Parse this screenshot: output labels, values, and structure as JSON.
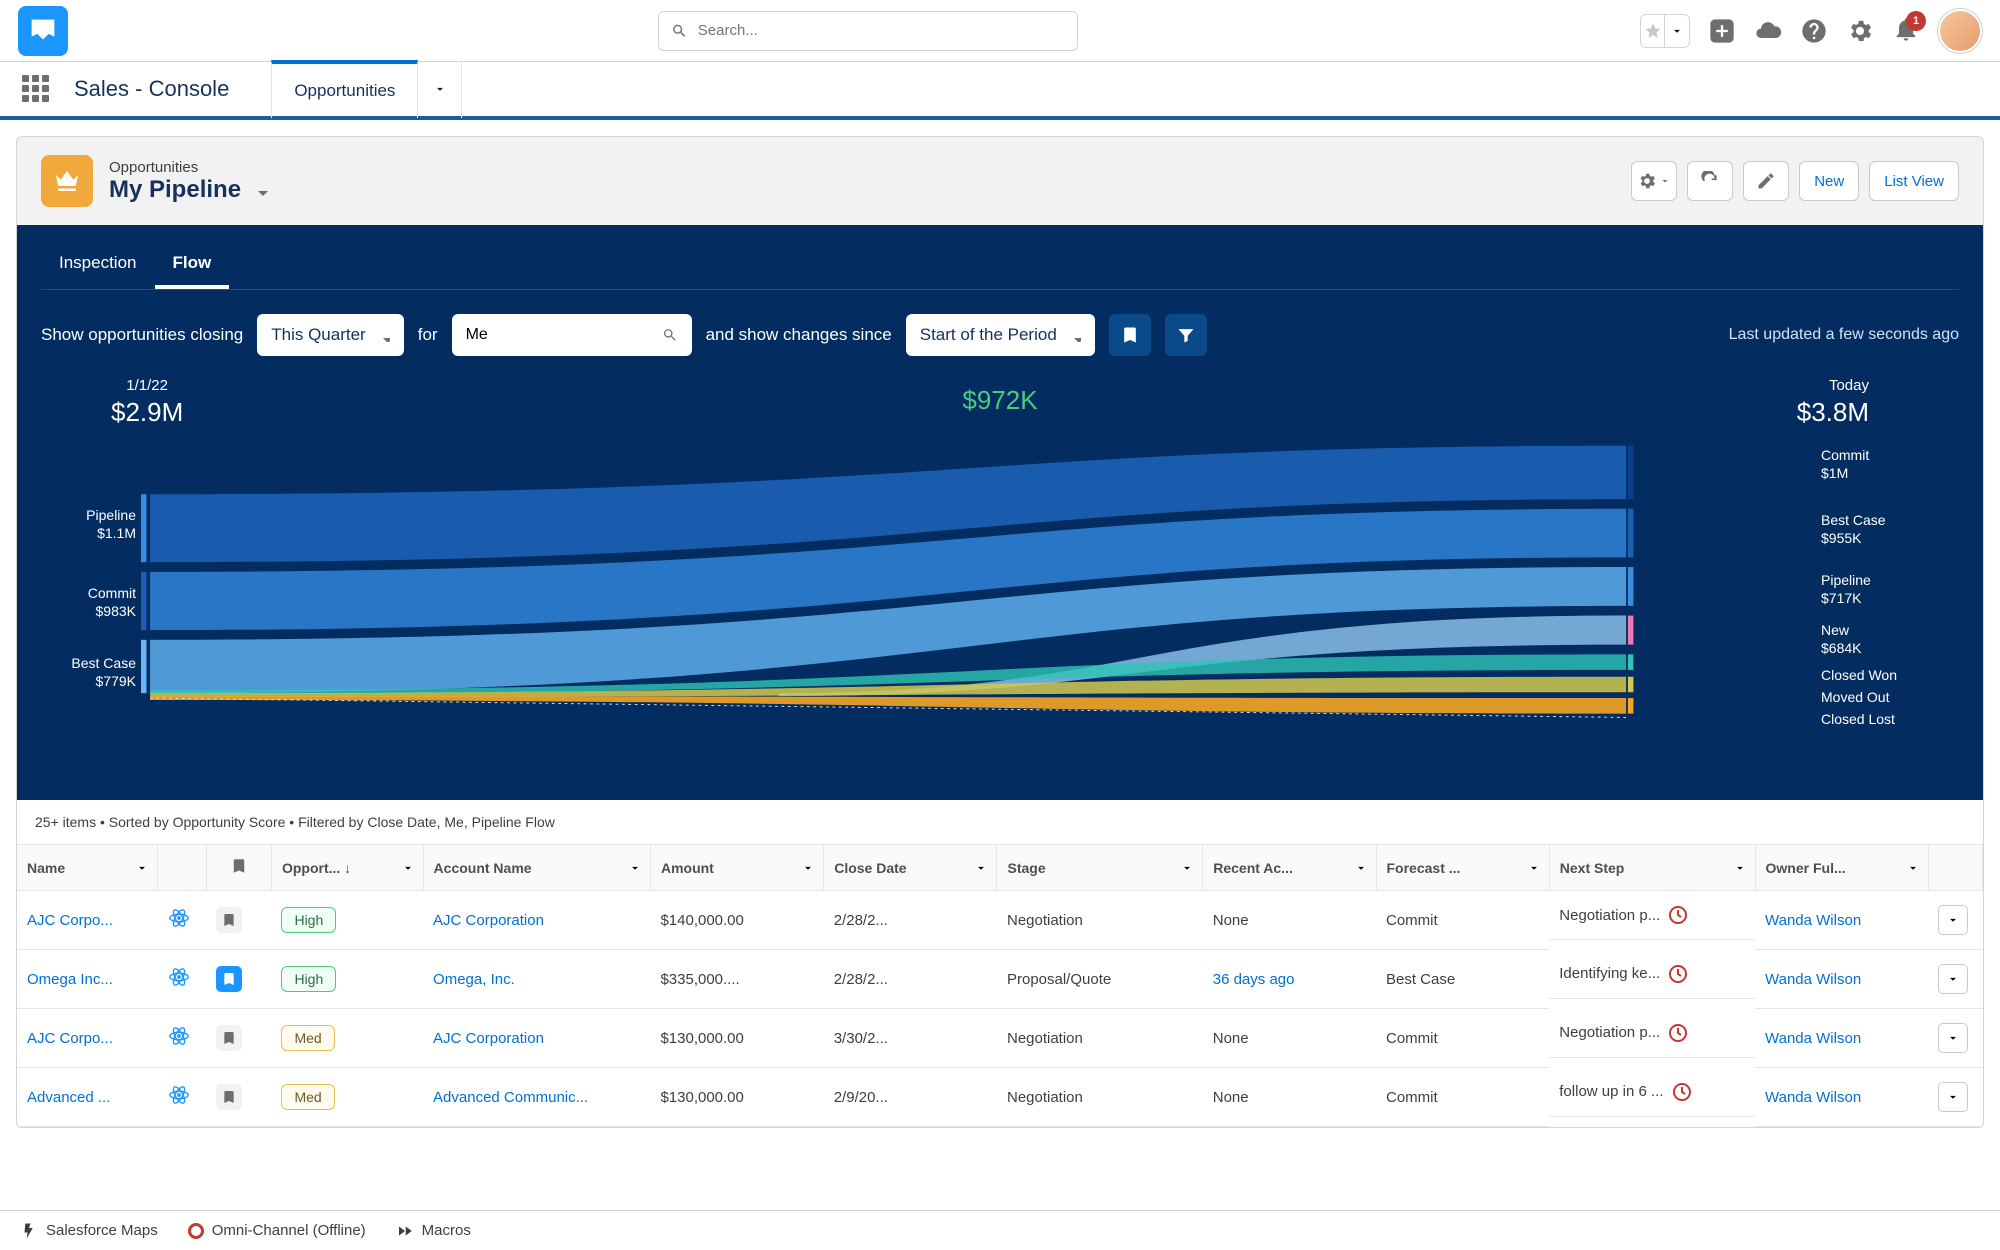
{
  "header": {
    "search_placeholder": "Search...",
    "notif_count": "1"
  },
  "nav": {
    "app_name": "Sales - Console",
    "tab": "Opportunities"
  },
  "page": {
    "object_label": "Opportunities",
    "view_name": "My Pipeline",
    "actions": {
      "new": "New",
      "listview": "List View"
    }
  },
  "tabs": {
    "inspection": "Inspection",
    "flow": "Flow"
  },
  "filters": {
    "lead": "Show opportunities closing",
    "period": "This Quarter",
    "for": "for",
    "who": "Me",
    "since_lbl": "and show changes since",
    "since": "Start of the Period",
    "updated": "Last updated a few seconds ago"
  },
  "sankey": {
    "left_date": "1/1/22",
    "left_total": "$2.9M",
    "right_date": "Today",
    "right_total": "$3.8M",
    "delta": "$972K",
    "left": [
      {
        "label": "Pipeline",
        "value": "$1.1M"
      },
      {
        "label": "Commit",
        "value": "$983K"
      },
      {
        "label": "Best Case",
        "value": "$779K"
      }
    ],
    "right": [
      {
        "label": "Commit",
        "value": "$1M"
      },
      {
        "label": "Best Case",
        "value": "$955K"
      },
      {
        "label": "Pipeline",
        "value": "$717K"
      },
      {
        "label": "New",
        "value": "$684K"
      },
      {
        "label": "Closed Won",
        "value": ""
      },
      {
        "label": "Moved Out",
        "value": ""
      },
      {
        "label": "Closed Lost",
        "value": ""
      }
    ]
  },
  "table": {
    "info": "25+ items • Sorted by Opportunity Score • Filtered by Close Date, Me, Pipeline Flow",
    "cols": {
      "name": "Name",
      "bk": "",
      "opp": "Opport...",
      "acct": "Account Name",
      "amt": "Amount",
      "close": "Close Date",
      "stage": "Stage",
      "recent": "Recent Ac...",
      "forecast": "Forecast ...",
      "next": "Next Step",
      "owner": "Owner Ful..."
    },
    "rows": [
      {
        "name": "AJC Corpo...",
        "bk": "off",
        "score": "High",
        "acct": "AJC Corporation",
        "amt": "$140,000.00",
        "close": "2/28/2...",
        "stage": "Negotiation",
        "recent": "None",
        "recent_link": false,
        "forecast": "Commit",
        "next": "Negotiation p...",
        "overdue": true,
        "owner": "Wanda Wilson"
      },
      {
        "name": "Omega Inc...",
        "bk": "on",
        "score": "High",
        "acct": "Omega, Inc.",
        "amt": "$335,000....",
        "close": "2/28/2...",
        "stage": "Proposal/Quote",
        "recent": "36 days ago",
        "recent_link": true,
        "forecast": "Best Case",
        "next": "Identifying ke...",
        "overdue": true,
        "owner": "Wanda Wilson"
      },
      {
        "name": "AJC Corpo...",
        "bk": "off",
        "score": "Med",
        "acct": "AJC Corporation",
        "amt": "$130,000.00",
        "close": "3/30/2...",
        "stage": "Negotiation",
        "recent": "None",
        "recent_link": false,
        "forecast": "Commit",
        "next": "Negotiation p...",
        "overdue": true,
        "owner": "Wanda Wilson"
      },
      {
        "name": "Advanced ...",
        "bk": "off",
        "score": "Med",
        "acct": "Advanced Communic...",
        "amt": "$130,000.00",
        "close": "2/9/20...",
        "stage": "Negotiation",
        "recent": "None",
        "recent_link": false,
        "forecast": "Commit",
        "next": "follow up in 6 ...",
        "overdue": true,
        "owner": "Wanda Wilson"
      }
    ]
  },
  "footer": {
    "maps": "Salesforce Maps",
    "omni": "Omni-Channel (Offline)",
    "macros": "Macros"
  },
  "chart_data": {
    "type": "sankey",
    "title": "Pipeline Flow",
    "delta": 972000,
    "left": {
      "date": "1/1/22",
      "total": 2900000,
      "categories": [
        {
          "name": "Pipeline",
          "value": 1100000
        },
        {
          "name": "Commit",
          "value": 983000
        },
        {
          "name": "Best Case",
          "value": 779000
        }
      ]
    },
    "right": {
      "date": "Today",
      "total": 3800000,
      "categories": [
        {
          "name": "Commit",
          "value": 1000000
        },
        {
          "name": "Best Case",
          "value": 955000
        },
        {
          "name": "Pipeline",
          "value": 717000
        },
        {
          "name": "New",
          "value": 684000
        },
        {
          "name": "Closed Won",
          "value": null
        },
        {
          "name": "Moved Out",
          "value": null
        },
        {
          "name": "Closed Lost",
          "value": null
        }
      ]
    }
  }
}
